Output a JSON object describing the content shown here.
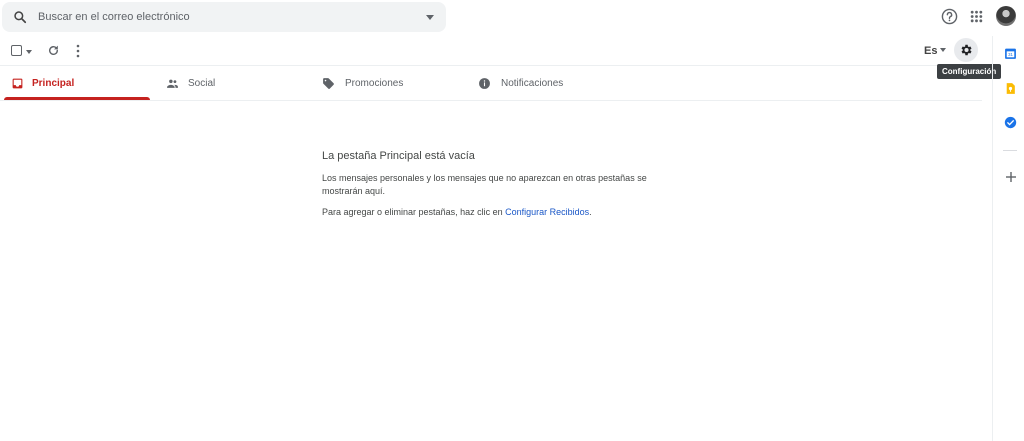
{
  "search": {
    "placeholder": "Buscar en el correo electrónico"
  },
  "toolbar": {
    "language": "Es",
    "settings_tooltip": "Configuración"
  },
  "tabs": [
    {
      "label": "Principal",
      "active": true,
      "icon": "inbox-icon"
    },
    {
      "label": "Social",
      "active": false,
      "icon": "people-icon"
    },
    {
      "label": "Promociones",
      "active": false,
      "icon": "tag-icon"
    },
    {
      "label": "Notificaciones",
      "active": false,
      "icon": "info-icon"
    }
  ],
  "empty_state": {
    "title": "La pestaña Principal está vacía",
    "body": "Los mensajes personales y los mensajes que no aparezcan en otras pestañas se mostrarán aquí.",
    "config_prefix": "Para agregar o eliminar pestañas, haz clic en ",
    "config_link": "Configurar Recibidos",
    "config_suffix": "."
  },
  "colors": {
    "accent": "#c5221f",
    "link": "#1a57c7",
    "search_bg": "#f1f3f4"
  },
  "rail_icons": [
    "calendar-icon",
    "keep-icon",
    "tasks-icon",
    "add-icon"
  ]
}
